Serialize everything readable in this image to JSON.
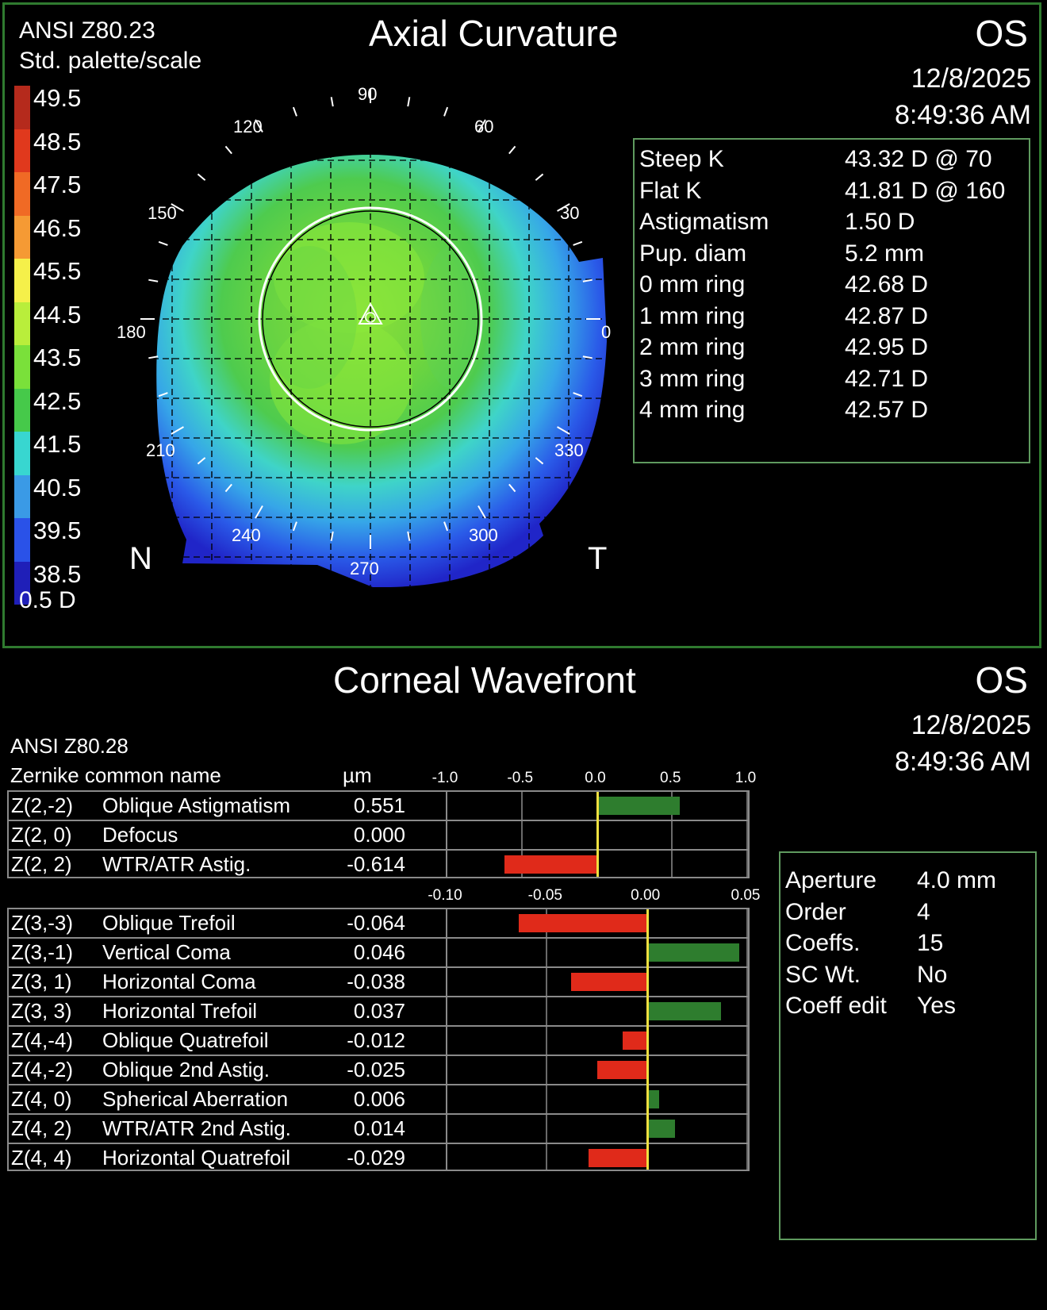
{
  "axial": {
    "standard": "ANSI Z80.23",
    "palette": "Std. palette/scale",
    "title": "Axial Curvature",
    "eye": "OS",
    "date": "12/8/2025",
    "time": "8:49:36 AM",
    "scale_step": "0.5 D",
    "legend": [
      {
        "label": "49.5",
        "color": "#b52a1c"
      },
      {
        "label": "48.5",
        "color": "#e0391d"
      },
      {
        "label": "47.5",
        "color": "#f06a25"
      },
      {
        "label": "46.5",
        "color": "#f59a34"
      },
      {
        "label": "45.5",
        "color": "#f5f04a"
      },
      {
        "label": "44.5",
        "color": "#b9ee3b"
      },
      {
        "label": "43.5",
        "color": "#7ae03a"
      },
      {
        "label": "42.5",
        "color": "#46c94a"
      },
      {
        "label": "41.5",
        "color": "#38d6d0"
      },
      {
        "label": "40.5",
        "color": "#3a9ae6"
      },
      {
        "label": "39.5",
        "color": "#2a52e8"
      },
      {
        "label": "38.5",
        "color": "#1f1fb8"
      }
    ],
    "angles": {
      "a90": "90",
      "a120": "120",
      "a60": "60",
      "a150": "150",
      "a30": "30",
      "a180": "180",
      "a0": "0",
      "a210": "210",
      "a330": "330",
      "a240": "240",
      "a300": "300",
      "a270": "270"
    },
    "nasal": "N",
    "temporal": "T",
    "stats": [
      {
        "label": "Steep K",
        "value": "43.32 D @ 70"
      },
      {
        "label": "Flat K",
        "value": "41.81 D @ 160"
      },
      {
        "label": "Astigmatism",
        "value": "1.50 D"
      },
      {
        "label": "Pup. diam",
        "value": "5.2 mm"
      },
      {
        "label": "0 mm ring",
        "value": "42.68 D"
      },
      {
        "label": "1 mm ring",
        "value": "42.87 D"
      },
      {
        "label": "2 mm ring",
        "value": "42.95 D"
      },
      {
        "label": "3 mm ring",
        "value": "42.71 D"
      },
      {
        "label": "4 mm ring",
        "value": "42.57 D"
      }
    ]
  },
  "wavefront": {
    "title": "Corneal Wavefront",
    "eye": "OS",
    "date": "12/8/2025",
    "time": "8:49:36 AM",
    "standard": "ANSI Z80.28",
    "col_name": "Zernike common name",
    "col_unit": "µm",
    "positive_color": "#2e7d2e",
    "negative_color": "#e02a1a",
    "zero_line_color": "#f0e040",
    "settings": [
      {
        "label": "Aperture",
        "value": "4.0 mm"
      },
      {
        "label": "Order",
        "value": "4"
      },
      {
        "label": "Coeffs.",
        "value": "15"
      },
      {
        "label": "SC  Wt.",
        "value": "No"
      },
      {
        "label": "Coeff edit",
        "value": "Yes"
      }
    ]
  },
  "chart_data": [
    {
      "type": "bar",
      "orientation": "horizontal",
      "xlim": [
        -1.0,
        1.0
      ],
      "ticks": [
        "-1.0",
        "-0.5",
        "0.0",
        "0.5",
        "1.0"
      ],
      "categories": [
        "Z(2,-2)",
        "Z(2, 0)",
        "Z(2, 2)"
      ],
      "names": [
        "Oblique Astigmatism",
        "Defocus",
        "WTR/ATR Astig."
      ],
      "labels": [
        "0.551",
        "0.000",
        "-0.614"
      ],
      "values": [
        0.551,
        0.0,
        -0.614
      ]
    },
    {
      "type": "bar",
      "orientation": "horizontal",
      "xlim": [
        -0.1,
        0.05
      ],
      "ticks": [
        "-0.10",
        "-0.05",
        "0.00",
        "0.05"
      ],
      "categories": [
        "Z(3,-3)",
        "Z(3,-1)",
        "Z(3, 1)",
        "Z(3, 3)",
        "Z(4,-4)",
        "Z(4,-2)",
        "Z(4, 0)",
        "Z(4, 2)",
        "Z(4, 4)"
      ],
      "names": [
        "Oblique Trefoil",
        "Vertical Coma",
        "Horizontal Coma",
        "Horizontal Trefoil",
        "Oblique Quatrefoil",
        "Oblique 2nd Astig.",
        "Spherical Aberration",
        "WTR/ATR 2nd Astig.",
        "Horizontal Quatrefoil"
      ],
      "labels": [
        "-0.064",
        "0.046",
        "-0.038",
        "0.037",
        "-0.012",
        "-0.025",
        "0.006",
        "0.014",
        "-0.029"
      ],
      "values": [
        -0.064,
        0.046,
        -0.038,
        0.037,
        -0.012,
        -0.025,
        0.006,
        0.014,
        -0.029
      ]
    }
  ]
}
